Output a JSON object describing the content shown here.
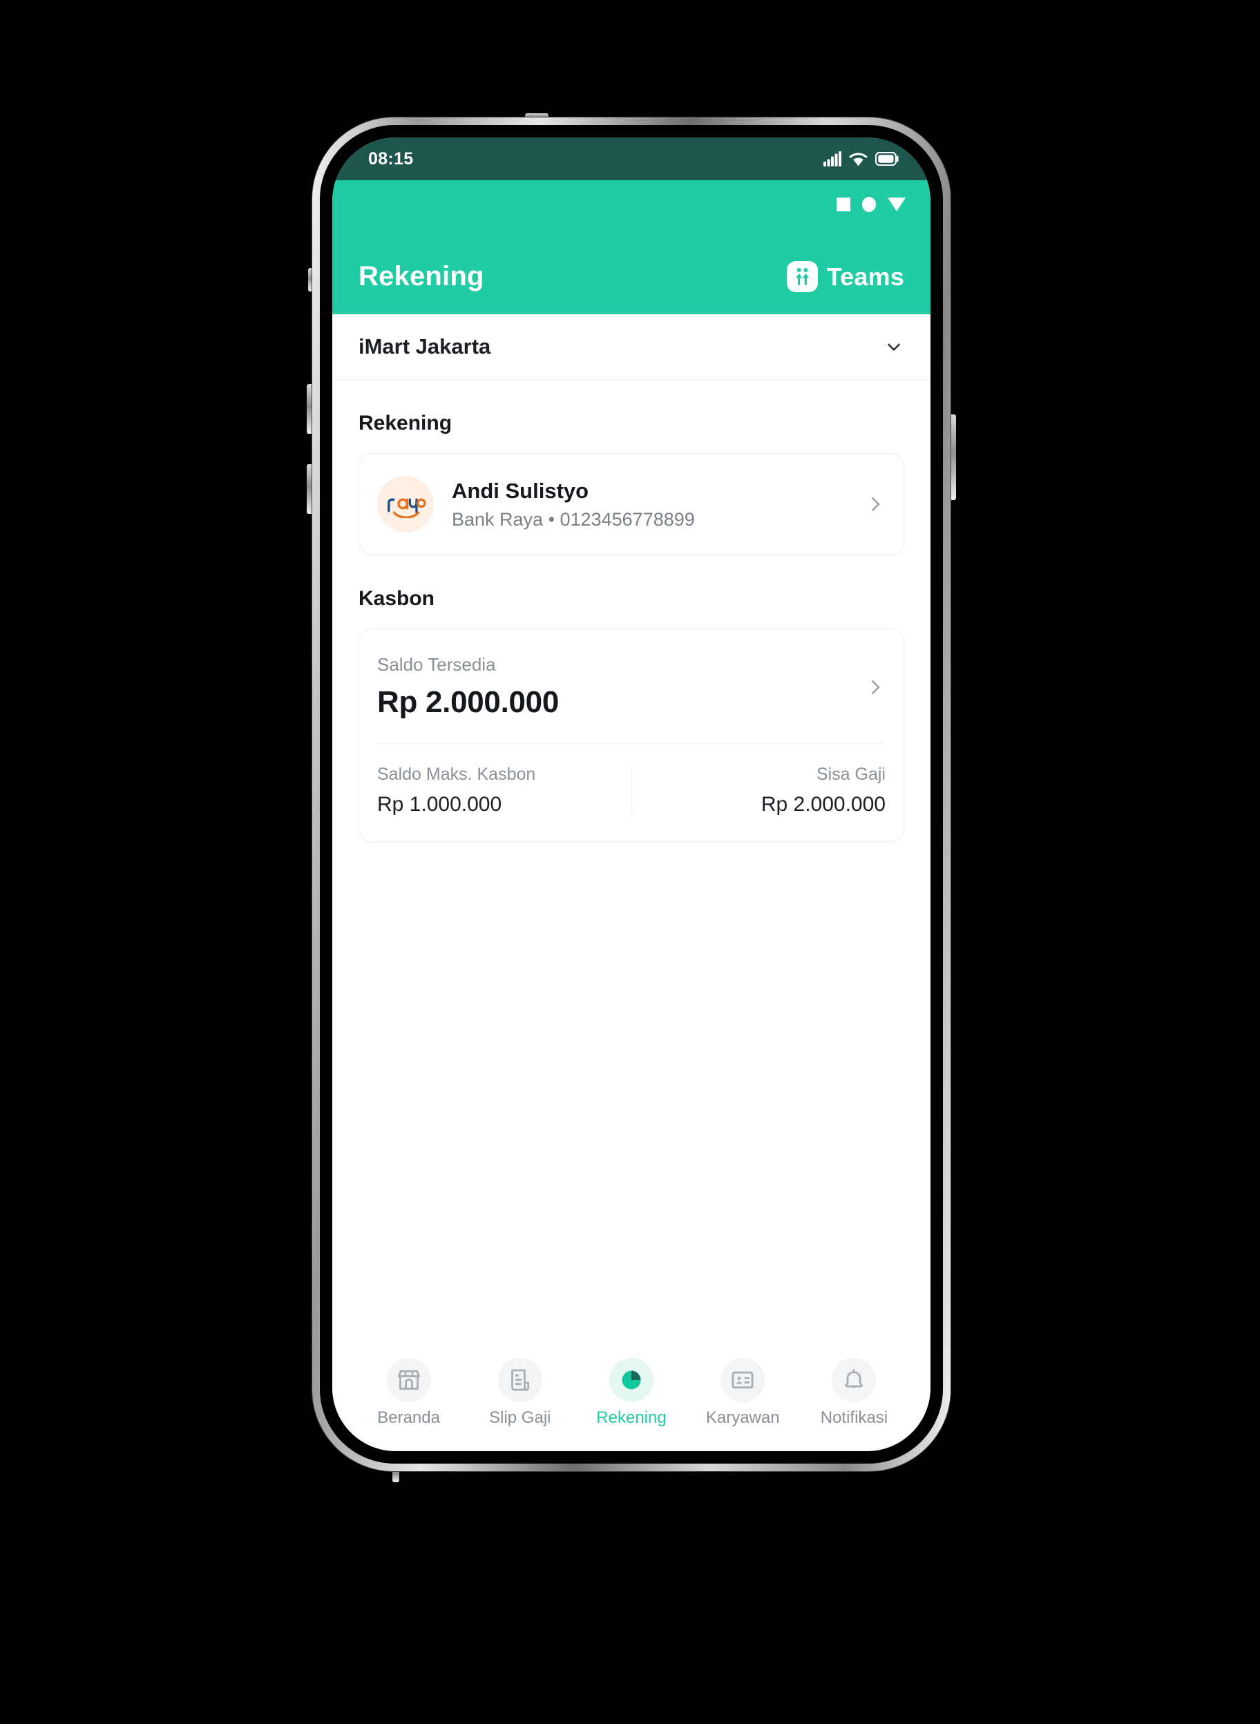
{
  "statusbar": {
    "time": "08:15",
    "icons": [
      "signal-icon",
      "wifi-icon",
      "battery-icon"
    ]
  },
  "android_nav": {
    "keys": [
      "recents-square-key",
      "home-circle-key",
      "back-triangle-key"
    ]
  },
  "appbar": {
    "title": "Rekening",
    "brand_label": "Teams",
    "brand_icon": "teams-logo-icon",
    "background_color": "#1FCCA3"
  },
  "company_selector": {
    "name": "iMart Jakarta",
    "chevron_icon": "chevron-down-icon"
  },
  "sections": {
    "rekening": {
      "heading": "Rekening",
      "account": {
        "logo_text": "raya",
        "logo_colors": {
          "primary": "#1C4E8F",
          "accent": "#E8701A",
          "bg": "#FDEFE4"
        },
        "name": "Andi Sulistyo",
        "bank": "Bank Raya",
        "separator": "•",
        "number": "0123456778899",
        "chevron_icon": "chevron-right-icon"
      }
    },
    "kasbon": {
      "heading": "Kasbon",
      "balance_label": "Saldo Tersedia",
      "balance_value": "Rp 2.000.000",
      "chevron_icon": "chevron-right-icon",
      "stats": [
        {
          "label": "Saldo Maks. Kasbon",
          "value": "Rp 1.000.000"
        },
        {
          "label": "Sisa Gaji",
          "value": "Rp 2.000.000"
        }
      ]
    }
  },
  "tabbar": {
    "active_color": "#1FCCA3",
    "items": [
      {
        "label": "Beranda",
        "icon": "store-icon",
        "active": false
      },
      {
        "label": "Slip Gaji",
        "icon": "document-icon",
        "active": false
      },
      {
        "label": "Rekening",
        "icon": "pie-chart-icon",
        "active": true
      },
      {
        "label": "Karyawan",
        "icon": "id-card-icon",
        "active": false
      },
      {
        "label": "Notifikasi",
        "icon": "bell-icon",
        "active": false
      }
    ]
  }
}
